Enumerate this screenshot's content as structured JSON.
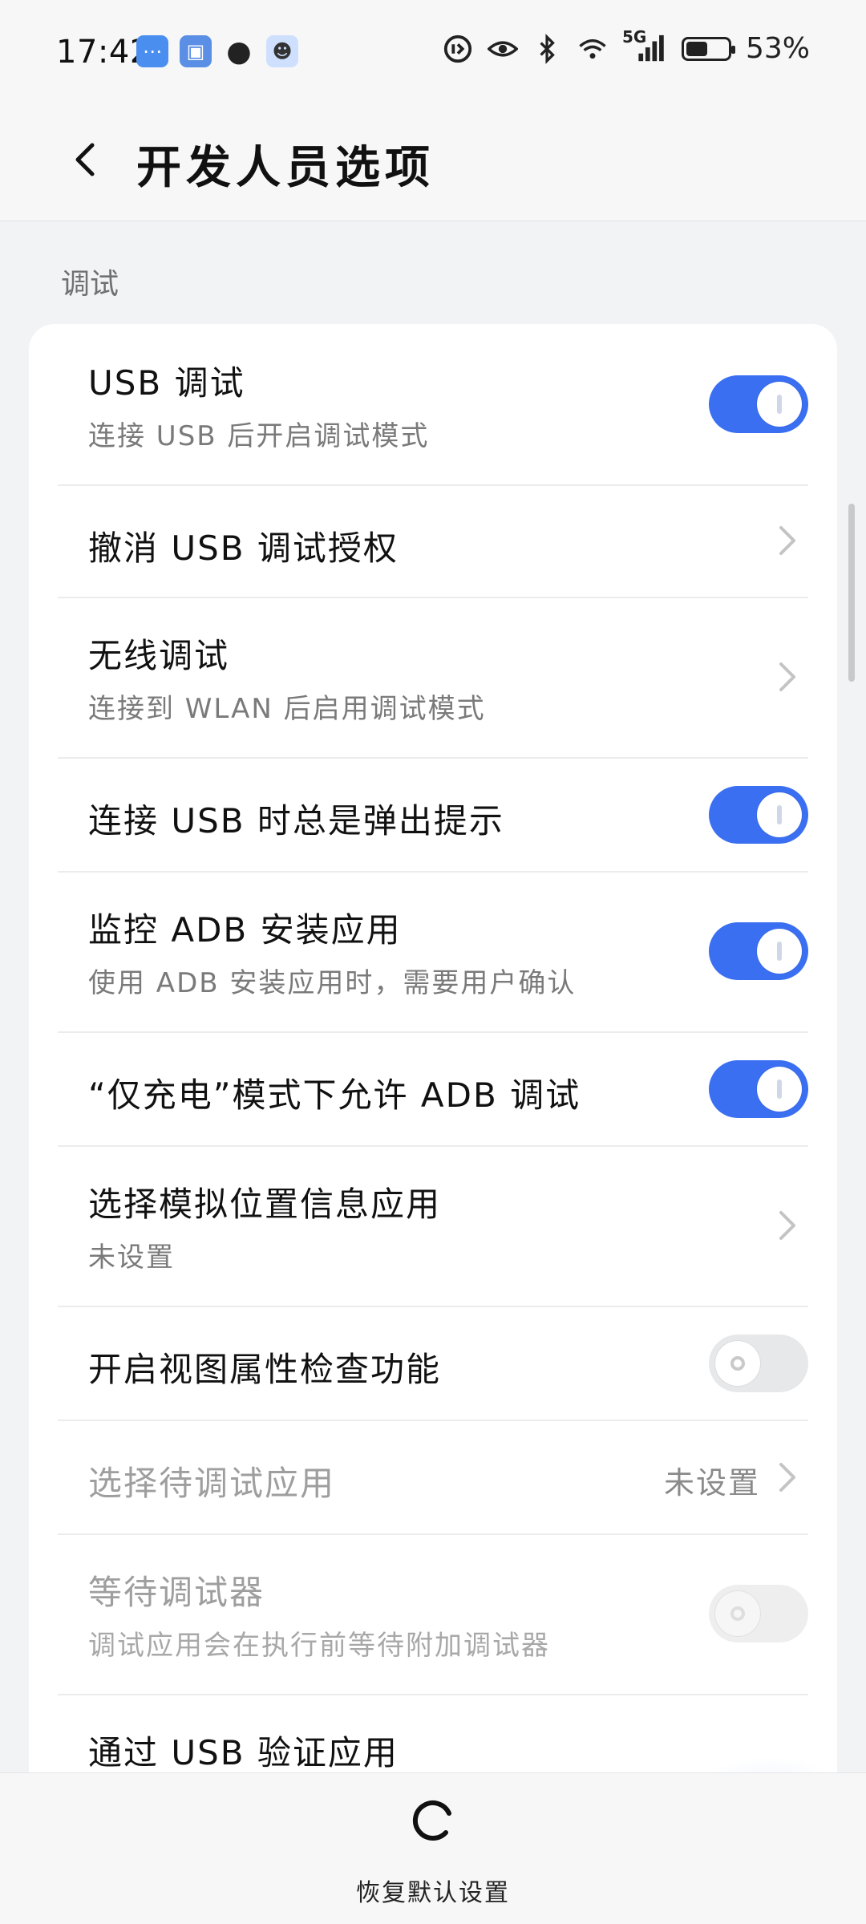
{
  "status_bar": {
    "time": "17:42",
    "battery_text": "53%",
    "network_label": "5G",
    "notification_icons": [
      "chat-icon",
      "id-card-icon",
      "qq-penguin-icon",
      "assistant-face-icon"
    ],
    "system_icons": [
      "hd-icon",
      "eye-icon",
      "bluetooth-icon",
      "wifi-icon",
      "cellular-signal-icon",
      "battery-icon"
    ]
  },
  "header": {
    "title": "开发人员选项",
    "back_icon": "chevron-left-icon"
  },
  "section": {
    "label": "调试"
  },
  "items": [
    {
      "title": "USB 调试",
      "subtitle": "连接 USB 后开启调试模式",
      "control": "switch",
      "on": true
    },
    {
      "title": "撤消 USB 调试授权",
      "control": "chevron"
    },
    {
      "title": "无线调试",
      "subtitle": "连接到 WLAN 后启用调试模式",
      "control": "chevron"
    },
    {
      "title": "连接 USB 时总是弹出提示",
      "control": "switch",
      "on": true
    },
    {
      "title": "监控 ADB 安装应用",
      "subtitle": "使用 ADB 安装应用时，需要用户确认",
      "control": "switch",
      "on": true
    },
    {
      "title": "“仅充电”模式下允许 ADB 调试",
      "control": "switch",
      "on": true
    },
    {
      "title": "选择模拟位置信息应用",
      "subtitle": "未设置",
      "control": "chevron"
    },
    {
      "title": "开启视图属性检查功能",
      "control": "switch",
      "on": false
    },
    {
      "title": "选择待调试应用",
      "value": "未设置",
      "control": "chevron",
      "disabled": true
    },
    {
      "title": "等待调试器",
      "subtitle": "调试应用会在执行前等待附加调试器",
      "control": "switch",
      "on": false,
      "disabled": true
    },
    {
      "title": "通过 USB 验证应用",
      "control": "switch",
      "on": true
    }
  ],
  "bottom": {
    "restore_label": "恢复默认设置",
    "restore_icon": "refresh-icon"
  },
  "colors": {
    "accent": "#3b6ff2",
    "background": "#f2f3f5",
    "card": "#ffffff"
  }
}
